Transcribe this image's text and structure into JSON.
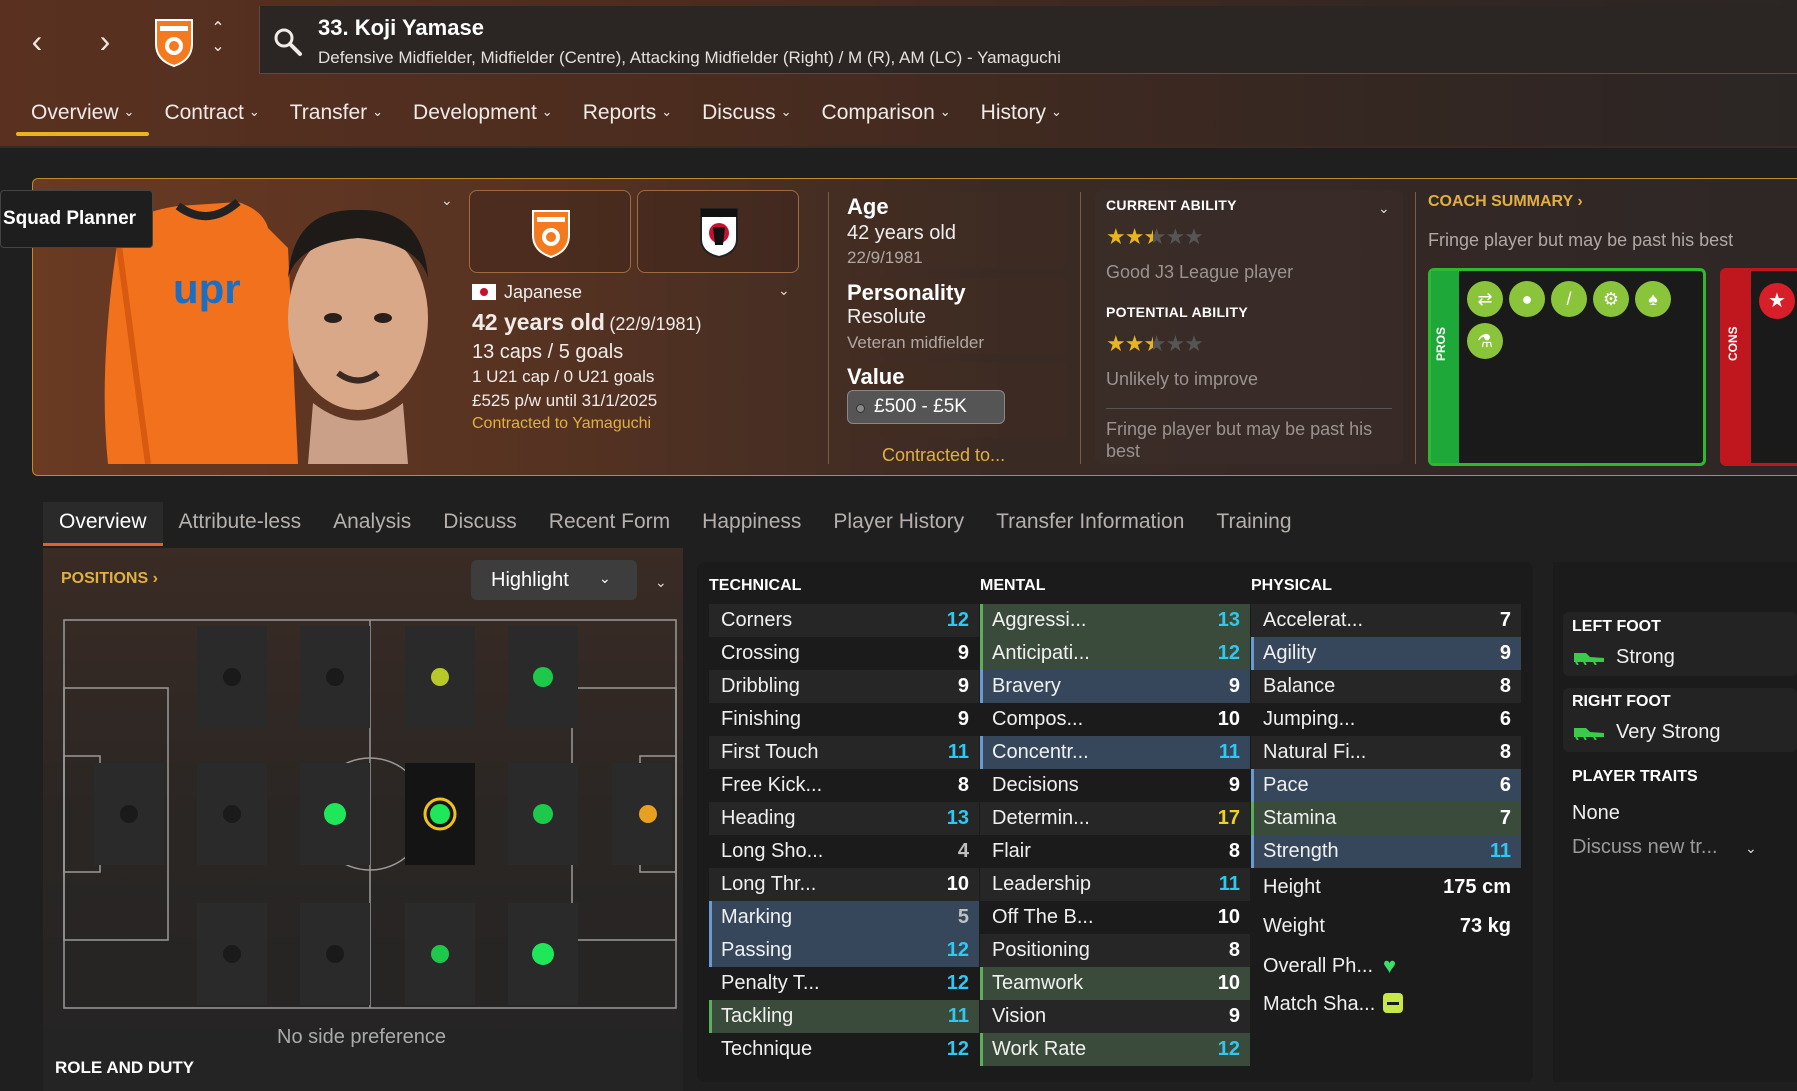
{
  "header": {
    "player_name": "33. Koji Yamase",
    "positions": "Defensive Midfielder, Midfielder (Centre), Attacking Midfielder (Right) / M (R), AM (LC) - Yamaguchi",
    "tabs": [
      {
        "label": "Overview",
        "active": true
      },
      {
        "label": "Contract"
      },
      {
        "label": "Transfer"
      },
      {
        "label": "Development"
      },
      {
        "label": "Reports"
      },
      {
        "label": "Discuss"
      },
      {
        "label": "Comparison"
      },
      {
        "label": "History"
      }
    ]
  },
  "profile": {
    "squad_planner": "Squad Planner",
    "nationality": "Japanese",
    "age_line": "42 years old",
    "dob_paren": "(22/9/1981)",
    "caps": "13 caps / 5 goals",
    "u21": "1 U21 cap / 0 U21 goals",
    "wage": "£525 p/w until 31/1/2025",
    "contracted": "Contracted to Yamaguchi",
    "age_label": "Age",
    "age_value": "42 years old",
    "dob": "22/9/1981",
    "personality_label": "Personality",
    "personality_value": "Resolute",
    "personality_sub": "Veteran midfielder",
    "value_label": "Value",
    "value": "£500 - £5K",
    "contracted_to": "Contracted to...",
    "current_ability_label": "CURRENT ABILITY",
    "current_ability_stars": 2.5,
    "current_ability_text": "Good J3 League player",
    "potential_ability_label": "POTENTIAL ABILITY",
    "potential_ability_stars": 2.5,
    "potential_ability_text": "Unlikely to improve",
    "ability_summary": "Fringe player but may be past his best",
    "coach_summary_title": "COACH SUMMARY",
    "coach_summary_text": "Fringe player but may be past his best",
    "pros_label": "PROS",
    "cons_label": "CONS"
  },
  "subtabs": [
    "Overview",
    "Attribute-less",
    "Analysis",
    "Discuss",
    "Recent Form",
    "Happiness",
    "Player History",
    "Transfer Information",
    "Training"
  ],
  "positions": {
    "title": "POSITIONS",
    "highlight": "Highlight",
    "no_side": "No side preference",
    "role_duty": "ROLE AND DUTY"
  },
  "attributes": {
    "technical_title": "TECHNICAL",
    "mental_title": "MENTAL",
    "physical_title": "PHYSICAL",
    "technical": [
      {
        "name": "Corners",
        "value": "12",
        "color": "c"
      },
      {
        "name": "Crossing",
        "value": "9",
        "color": "w"
      },
      {
        "name": "Dribbling",
        "value": "9",
        "color": "w"
      },
      {
        "name": "Finishing",
        "value": "9",
        "color": "w"
      },
      {
        "name": "First Touch",
        "value": "11",
        "color": "c"
      },
      {
        "name": "Free Kick...",
        "value": "8",
        "color": "w"
      },
      {
        "name": "Heading",
        "value": "13",
        "color": "c"
      },
      {
        "name": "Long Sho...",
        "value": "4",
        "color": "g"
      },
      {
        "name": "Long Thr...",
        "value": "10",
        "color": "w"
      },
      {
        "name": "Marking",
        "value": "5",
        "color": "g",
        "hl": "blue"
      },
      {
        "name": "Passing",
        "value": "12",
        "color": "c",
        "hl": "blue"
      },
      {
        "name": "Penalty T...",
        "value": "12",
        "color": "c"
      },
      {
        "name": "Tackling",
        "value": "11",
        "color": "c",
        "hl": "green"
      },
      {
        "name": "Technique",
        "value": "12",
        "color": "c"
      }
    ],
    "mental": [
      {
        "name": "Aggressi...",
        "value": "13",
        "color": "c",
        "hl": "green"
      },
      {
        "name": "Anticipati...",
        "value": "12",
        "color": "c",
        "hl": "green"
      },
      {
        "name": "Bravery",
        "value": "9",
        "color": "w",
        "hl": "blue"
      },
      {
        "name": "Compos...",
        "value": "10",
        "color": "w"
      },
      {
        "name": "Concentr...",
        "value": "11",
        "color": "c",
        "hl": "blue"
      },
      {
        "name": "Decisions",
        "value": "9",
        "color": "w"
      },
      {
        "name": "Determin...",
        "value": "17",
        "color": "y"
      },
      {
        "name": "Flair",
        "value": "8",
        "color": "w"
      },
      {
        "name": "Leadership",
        "value": "11",
        "color": "c"
      },
      {
        "name": "Off The B...",
        "value": "10",
        "color": "w"
      },
      {
        "name": "Positioning",
        "value": "8",
        "color": "w"
      },
      {
        "name": "Teamwork",
        "value": "10",
        "color": "w",
        "hl": "green"
      },
      {
        "name": "Vision",
        "value": "9",
        "color": "w"
      },
      {
        "name": "Work Rate",
        "value": "12",
        "color": "c",
        "hl": "green"
      }
    ],
    "physical": [
      {
        "name": "Accelerat...",
        "value": "7",
        "color": "w"
      },
      {
        "name": "Agility",
        "value": "9",
        "color": "w",
        "hl": "blue"
      },
      {
        "name": "Balance",
        "value": "8",
        "color": "w"
      },
      {
        "name": "Jumping...",
        "value": "6",
        "color": "w"
      },
      {
        "name": "Natural Fi...",
        "value": "8",
        "color": "w"
      },
      {
        "name": "Pace",
        "value": "6",
        "color": "w",
        "hl": "blue"
      },
      {
        "name": "Stamina",
        "value": "7",
        "color": "w",
        "hl": "green"
      },
      {
        "name": "Strength",
        "value": "11",
        "color": "c",
        "hl": "blue"
      }
    ],
    "height_label": "Height",
    "height_value": "175 cm",
    "weight_label": "Weight",
    "weight_value": "73 kg",
    "overall_label": "Overall Ph...",
    "match_label": "Match Sha..."
  },
  "side": {
    "left_foot_label": "LEFT FOOT",
    "left_foot_value": "Strong",
    "right_foot_label": "RIGHT FOOT",
    "right_foot_value": "Very Strong",
    "traits_label": "PLAYER TRAITS",
    "traits_value": "None",
    "traits_discuss": "Discuss new tr..."
  },
  "colors": {
    "accent": "#e8b420",
    "highlight_cyan": "#2ec8f0",
    "highlight_yellow": "#f0d020",
    "pros_green": "#1fa83a",
    "cons_red": "#c0161e"
  }
}
